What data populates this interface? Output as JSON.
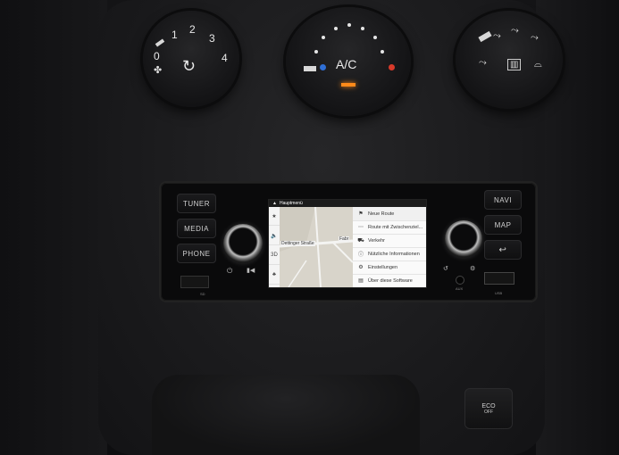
{
  "climate": {
    "fan_knob": {
      "scale": [
        "0",
        "1",
        "2",
        "3",
        "4"
      ],
      "fan_icon": "fan-icon",
      "recirc_icon": "recirculation-icon"
    },
    "temp_knob": {
      "label": "A/C",
      "cold_color": "#2f6fd6",
      "hot_color": "#d83a2a",
      "indicator_color": "#ff8a1a"
    },
    "mode_knob": {
      "icons": [
        "face-vent-icon",
        "face-floor-vent-icon",
        "floor-vent-icon",
        "floor-defrost-icon",
        "rear-defrost-icon",
        "windshield-defrost-icon"
      ]
    }
  },
  "radio": {
    "left_buttons": [
      "TUNER",
      "MEDIA",
      "PHONE"
    ],
    "right_buttons": [
      "NAVI",
      "MAP"
    ],
    "back_icon": "back-arrow-icon",
    "usb_label_left": "SD",
    "usb_label_right": "USB",
    "aux_label": "AUX"
  },
  "screen": {
    "title": "Hauptmenü",
    "toolbar": [
      "★",
      "🔈",
      "3D",
      "♣"
    ],
    "map_labels": [
      "Dettinger Straße",
      "Fabr"
    ],
    "menu_items": [
      {
        "icon": "flag-icon",
        "label": "Neue Route"
      },
      {
        "icon": "waypoints-icon",
        "label": "Route mit Zwischenziel..."
      },
      {
        "icon": "traffic-icon",
        "label": "Verkehr"
      },
      {
        "icon": "info-icon",
        "label": "Nützliche Informationen"
      },
      {
        "icon": "settings-icon",
        "label": "Einstellungen"
      },
      {
        "icon": "about-icon",
        "label": "Über diese Software"
      }
    ]
  },
  "console": {
    "eco_label": "ECO",
    "eco_sub": "OFF"
  }
}
